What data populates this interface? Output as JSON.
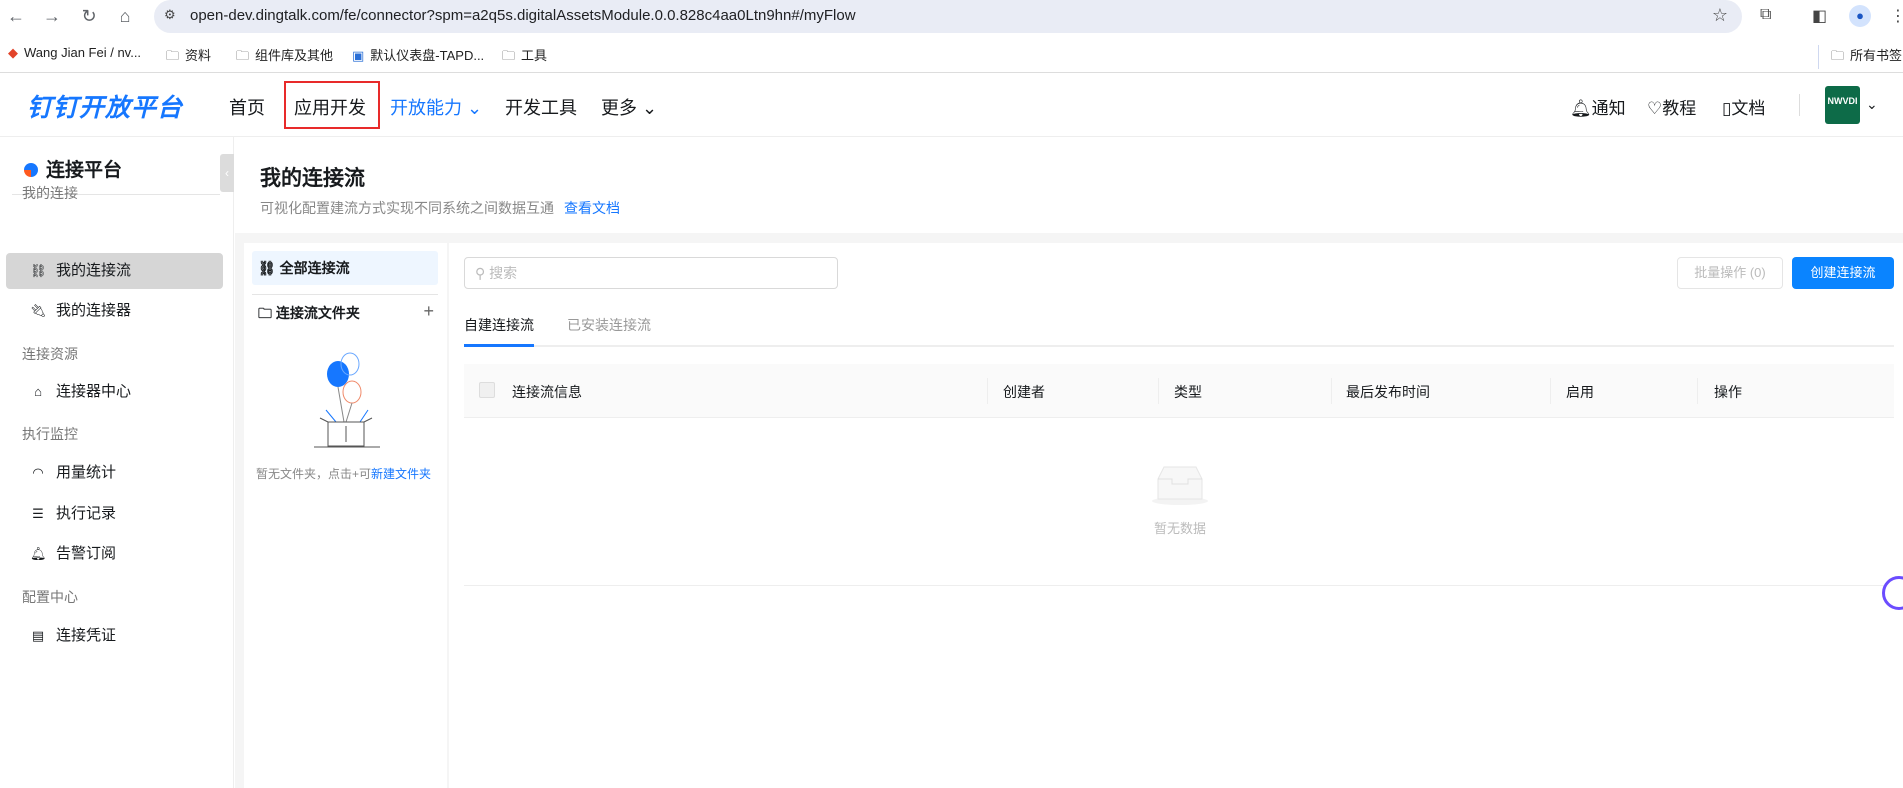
{
  "browser": {
    "url": "open-dev.dingtalk.com/fe/connector?spm=a2q5s.digitalAssetsModule.0.0.828c4aa0Ltn9hn#/myFlow",
    "bookmarks": [
      "Wang Jian Fei / nv...",
      "资料",
      "组件库及其他",
      "默认仪表盘-TAPD...",
      "工具"
    ],
    "all_bookmarks": "所有书签"
  },
  "header": {
    "logo": "钉钉开放平台",
    "nav": [
      "首页",
      "应用开发",
      "开放能力",
      "开发工具",
      "更多"
    ],
    "right": [
      "通知",
      "教程",
      "文档"
    ],
    "avatar": "NWVDI"
  },
  "sidebar": {
    "title": "连接平台",
    "sections": [
      {
        "label": "我的连接",
        "items": [
          "我的连接流",
          "我的连接器"
        ]
      },
      {
        "label": "连接资源",
        "items": [
          "连接器中心"
        ]
      },
      {
        "label": "执行监控",
        "items": [
          "用量统计",
          "执行记录",
          "告警订阅"
        ]
      },
      {
        "label": "配置中心",
        "items": [
          "连接凭证"
        ]
      }
    ]
  },
  "page": {
    "title": "我的连接流",
    "subtitle": "可视化配置建流方式实现不同系统之间数据互通",
    "doc_link": "查看文档"
  },
  "left_panel": {
    "all": "全部连接流",
    "folder": "连接流文件夹",
    "empty_text": "暂无文件夹，点击+可",
    "empty_link": "新建文件夹"
  },
  "main": {
    "search_placeholder": "搜索",
    "batch": "批量操作 (0)",
    "create": "创建连接流",
    "tabs": [
      "自建连接流",
      "已安装连接流"
    ],
    "columns": [
      "连接流信息",
      "创建者",
      "类型",
      "最后发布时间",
      "启用",
      "操作"
    ],
    "empty": "暂无数据"
  },
  "colors": {
    "accent": "#1677ff",
    "highlight": "#e82a2a"
  }
}
